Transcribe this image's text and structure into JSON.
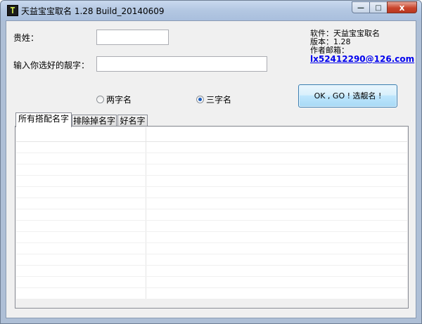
{
  "window": {
    "title": "天益宝宝取名 1.28 Build_20140609",
    "icon_glyph": "T",
    "controls": {
      "minimize": "—",
      "maximize": "□",
      "close": "x"
    }
  },
  "form": {
    "surname_label": "贵姓：",
    "surname_value": "",
    "chosen_char_label": "输入你选好的靓字：",
    "chosen_char_value": ""
  },
  "info": {
    "software": "软件：天益宝宝取名",
    "version": "版本：1.28",
    "author_email_label": "作者邮箱：",
    "email": "lx52412290@126.com"
  },
  "options": {
    "two_char": {
      "label": "两字名",
      "selected": false
    },
    "three_char": {
      "label": "三字名",
      "selected": true
    }
  },
  "action_button": {
    "label": "OK , GO ! 选靓名 !"
  },
  "tabs": [
    {
      "label": "所有搭配名字",
      "active": true
    },
    {
      "label": "排除掉名字",
      "active": false
    },
    {
      "label": "好名字",
      "active": false
    }
  ],
  "list": {
    "rows": []
  },
  "colors": {
    "accent": "#3c7fb1",
    "link": "#0000ee",
    "close": "#c9452c"
  }
}
